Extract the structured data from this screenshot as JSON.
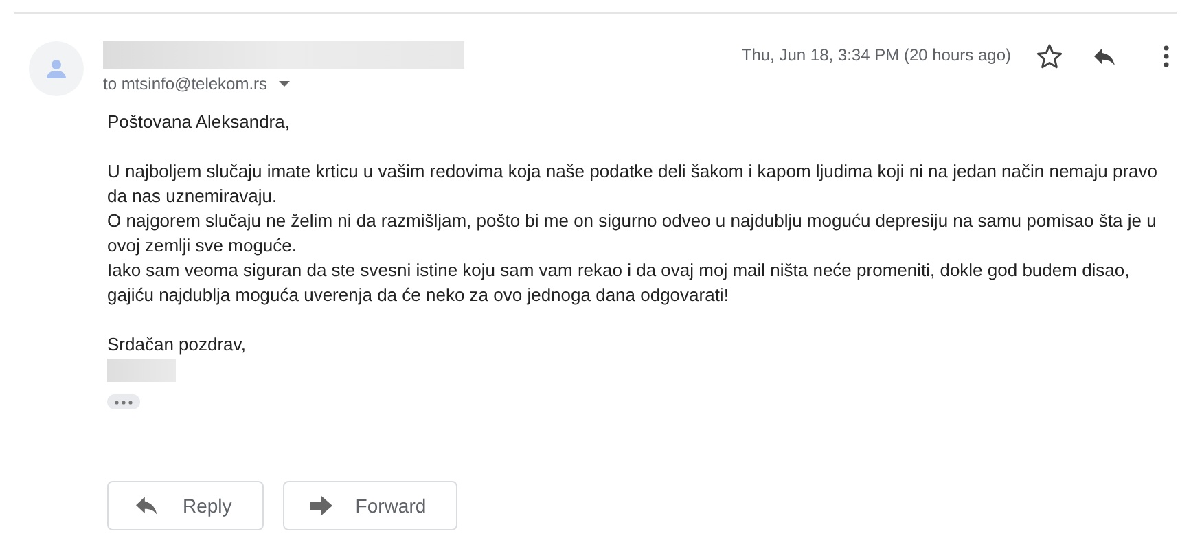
{
  "message": {
    "recipient": "to mtsinfo@telekom.rs",
    "date": "Thu, Jun 18, 3:34 PM (20 hours ago)",
    "starred": false,
    "greeting": "Poštovana Aleksandra,",
    "paragraphs": [
      "U najboljem slučaju imate krticu u vašim redovima koja naše podatke deli šakom i kapom ljudima koji ni na jedan način nemaju pravo da nas uznemiravaju.",
      "O najgorem slučaju ne želim ni da razmišljam, pošto bi me on sigurno odveo u najdublju moguću depresiju na samu pomisao šta je u ovoj zemlji sve moguće.",
      "Iako sam veoma siguran da ste svesni istine koju sam vam rekao i da ovaj moj mail ništa neće promeniti, dokle god budem disao, gajiću najdublja moguća uverenja da će neko za ovo jednoga dana odgovarati!"
    ],
    "closing": "Srdačan pozdrav,"
  },
  "actions": [
    {
      "kind": "reply",
      "label": "Reply"
    },
    {
      "kind": "forward",
      "label": "Forward"
    }
  ]
}
